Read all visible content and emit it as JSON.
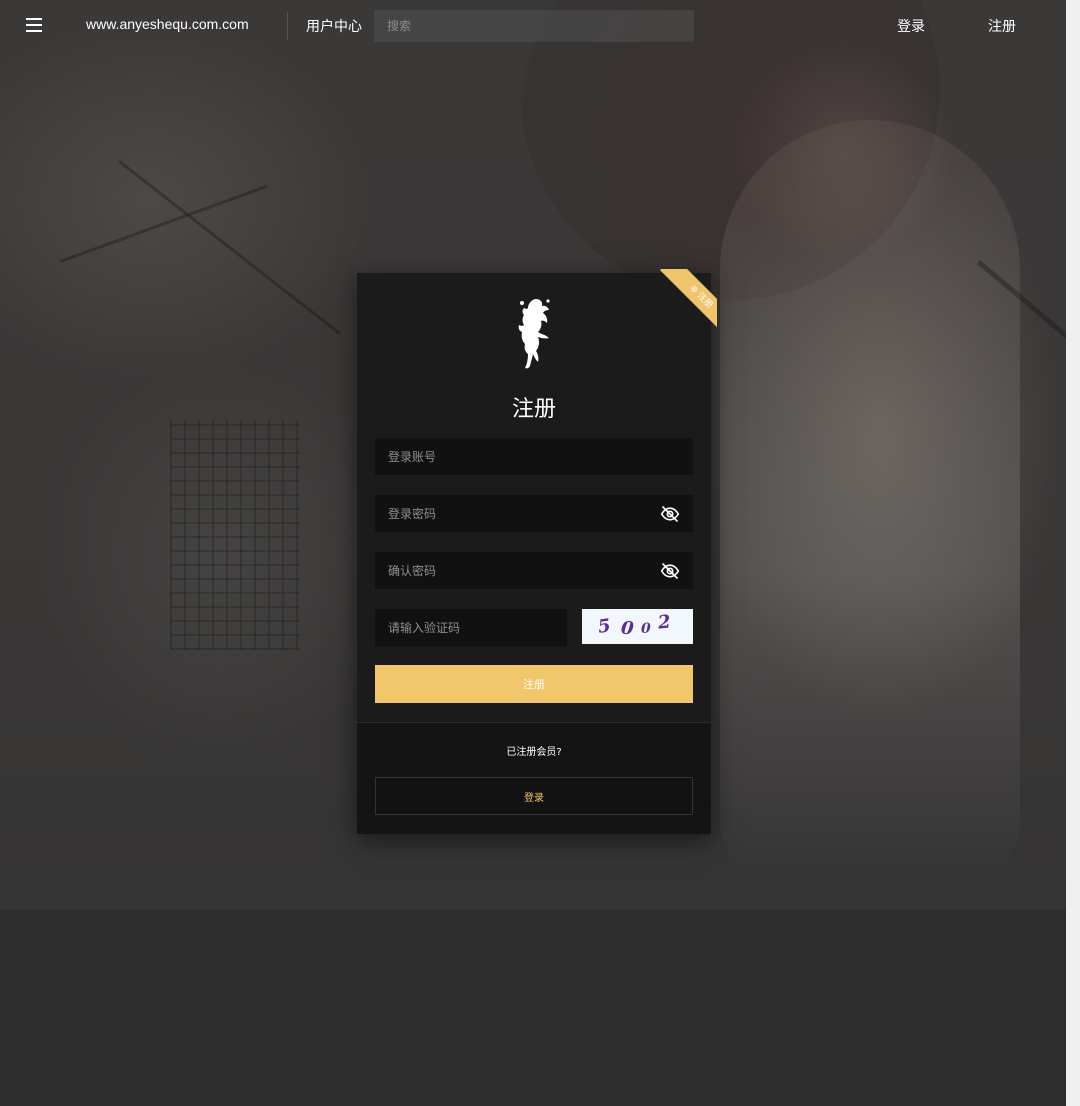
{
  "header": {
    "site_name": "www.anyeshequ.com.com",
    "user_center": "用户中心",
    "search_placeholder": "搜索",
    "login_label": "登录",
    "register_label": "注册"
  },
  "card": {
    "ribbon_label": "⊕ 注册",
    "title": "注册",
    "account_placeholder": "登录账号",
    "password_placeholder": "登录密码",
    "confirm_placeholder": "确认密码",
    "captcha_placeholder": "请输入验证码",
    "captcha_digits": [
      "5",
      "0",
      "0",
      "2"
    ],
    "submit_label": "注册",
    "already_member": "已注册会员?",
    "login_label": "登录"
  },
  "icons": {
    "menu": "menu-icon",
    "eye_off": "eye-off-icon",
    "logo": "dancer-logo"
  },
  "colors": {
    "accent": "#f2c66b",
    "card_bg": "#1b1b1b",
    "input_bg": "#111111",
    "captcha_text": "#5a2aa0"
  }
}
